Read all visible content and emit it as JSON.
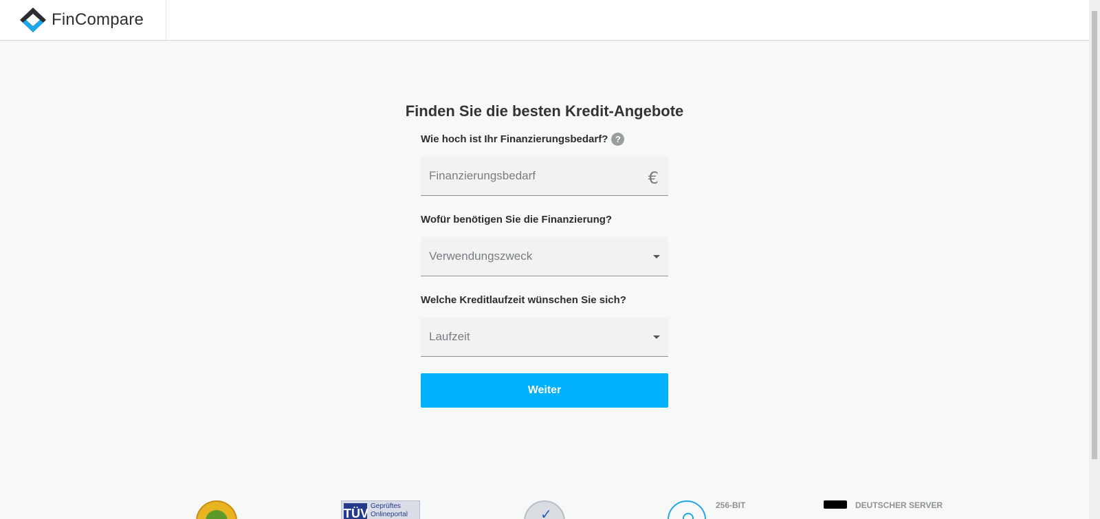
{
  "header": {
    "brand": "FinCompare",
    "colors": {
      "logo_dark": "#2b2f33",
      "logo_blue": "#1ea7e8"
    }
  },
  "main": {
    "title": "Finden Sie die besten Kredit-Angebote",
    "questions": [
      {
        "label": "Wie hoch ist Ihr Finanzierungsbedarf?",
        "help_icon": "?",
        "placeholder": "Finanzierungsbedarf",
        "suffix_icon": "€"
      },
      {
        "label": "Wofür benötigen Sie die Finanzierung?",
        "select_value": "Verwendungszweck"
      },
      {
        "label": "Welche Kreditlaufzeit wünschen Sie sich?",
        "select_value": "Laufzeit"
      }
    ],
    "submit_label": "Weiter",
    "colors": {
      "accent": "#00b0fa",
      "field_bg": "#f1f2f3"
    }
  },
  "badges": {
    "tuv_logo": "TÜV",
    "tuv_text": "Geprüftes Onlineportal",
    "ssl_text": "256-BIT",
    "server_text": "DEUTSCHER SERVER"
  }
}
